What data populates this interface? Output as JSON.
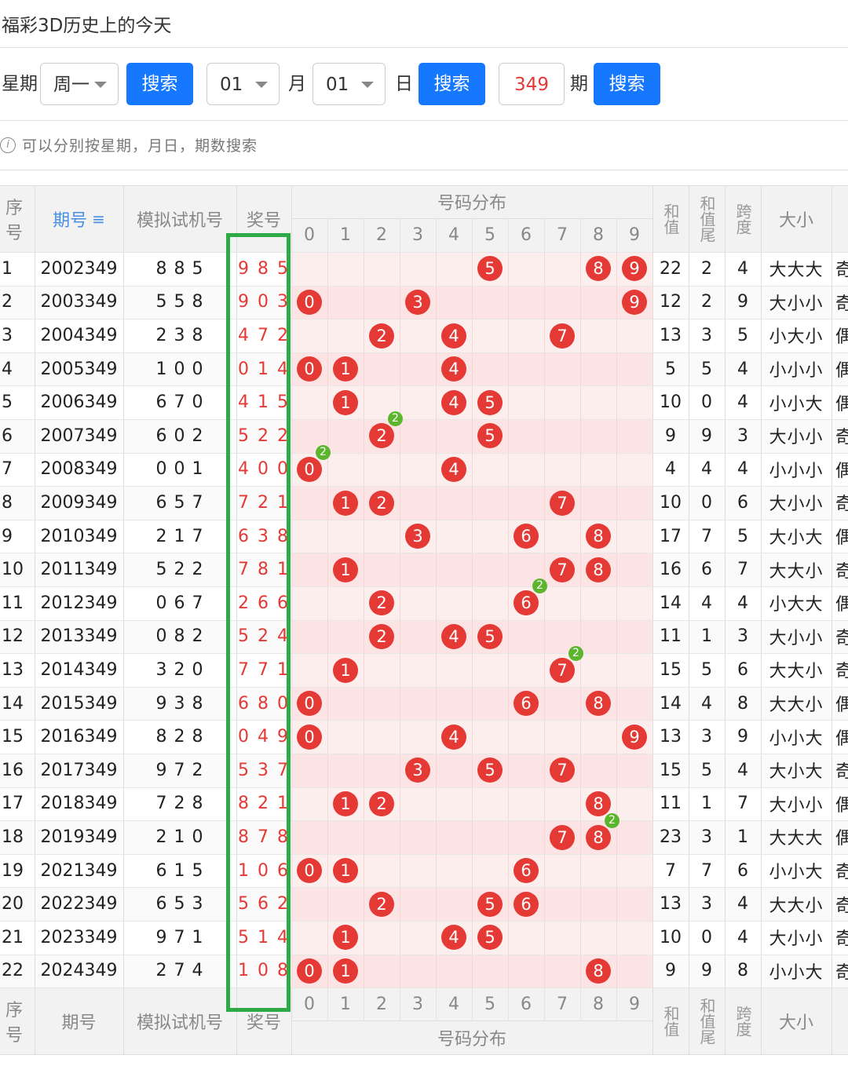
{
  "title": "福彩3D历史上的今天",
  "filters": {
    "weekday_label": "星期",
    "weekday_value": "周一",
    "search_label": "搜索",
    "month_value": "01",
    "month_label": "月",
    "day_value": "01",
    "day_label": "日",
    "issue_value": "349",
    "issue_label": "期"
  },
  "hint": "可以分别按星期，月日，期数搜索",
  "hint_icon": "info-icon",
  "table": {
    "headers": {
      "seq": "序号",
      "period": "期号",
      "period_sort_icon": "sort-icon",
      "sim": "模拟试机号",
      "prize": "奖号",
      "dist": "号码分布",
      "sum": "和值",
      "sum_tail": "和值尾",
      "span": "跨度",
      "size": "大小",
      "digits": [
        "0",
        "1",
        "2",
        "3",
        "4",
        "5",
        "6",
        "7",
        "8",
        "9"
      ]
    },
    "footer": {
      "seq": "序号",
      "period": "期号",
      "sim": "模拟试机号",
      "prize": "奖号",
      "dist": "号码分布",
      "sum": "和值",
      "sum_tail": "和值尾",
      "span": "跨度",
      "size": "大小"
    },
    "rows": [
      {
        "seq": "1",
        "period": "2002349",
        "sim": "8 8 5",
        "prize": "9 8 5",
        "balls": [
          5,
          8,
          9
        ],
        "dup": null,
        "sum": "22",
        "tail": "2",
        "span": "4",
        "size": "大大大",
        "extra": "奇"
      },
      {
        "seq": "2",
        "period": "2003349",
        "sim": "5 5 8",
        "prize": "9 0 3",
        "balls": [
          0,
          3,
          9
        ],
        "dup": null,
        "sum": "12",
        "tail": "2",
        "span": "9",
        "size": "大小小",
        "extra": "奇"
      },
      {
        "seq": "3",
        "period": "2004349",
        "sim": "2 3 8",
        "prize": "4 7 2",
        "balls": [
          2,
          4,
          7
        ],
        "dup": null,
        "sum": "13",
        "tail": "3",
        "span": "5",
        "size": "小大小",
        "extra": "偶"
      },
      {
        "seq": "4",
        "period": "2005349",
        "sim": "1 0 0",
        "prize": "0 1 4",
        "balls": [
          0,
          1,
          4
        ],
        "dup": null,
        "sum": "5",
        "tail": "5",
        "span": "4",
        "size": "小小小",
        "extra": "偶"
      },
      {
        "seq": "5",
        "period": "2006349",
        "sim": "6 7 0",
        "prize": "4 1 5",
        "balls": [
          1,
          4,
          5
        ],
        "dup": null,
        "sum": "10",
        "tail": "0",
        "span": "4",
        "size": "小小大",
        "extra": "偶"
      },
      {
        "seq": "6",
        "period": "2007349",
        "sim": "6 0 2",
        "prize": "5 2 2",
        "balls": [
          2,
          5
        ],
        "dup": 2,
        "sum": "9",
        "tail": "9",
        "span": "3",
        "size": "大小小",
        "extra": "奇"
      },
      {
        "seq": "7",
        "period": "2008349",
        "sim": "0 0 1",
        "prize": "4 0 0",
        "balls": [
          0,
          4
        ],
        "dup": 0,
        "sum": "4",
        "tail": "4",
        "span": "4",
        "size": "小小小",
        "extra": "偶"
      },
      {
        "seq": "8",
        "period": "2009349",
        "sim": "6 5 7",
        "prize": "7 2 1",
        "balls": [
          1,
          2,
          7
        ],
        "dup": null,
        "sum": "10",
        "tail": "0",
        "span": "6",
        "size": "大小小",
        "extra": "奇"
      },
      {
        "seq": "9",
        "period": "2010349",
        "sim": "2 1 7",
        "prize": "6 3 8",
        "balls": [
          3,
          6,
          8
        ],
        "dup": null,
        "sum": "17",
        "tail": "7",
        "span": "5",
        "size": "大小大",
        "extra": "偶"
      },
      {
        "seq": "10",
        "period": "2011349",
        "sim": "5 2 2",
        "prize": "7 8 1",
        "balls": [
          1,
          7,
          8
        ],
        "dup": null,
        "sum": "16",
        "tail": "6",
        "span": "7",
        "size": "大大小",
        "extra": "奇"
      },
      {
        "seq": "11",
        "period": "2012349",
        "sim": "0 6 7",
        "prize": "2 6 6",
        "balls": [
          2,
          6
        ],
        "dup": 6,
        "sum": "14",
        "tail": "4",
        "span": "4",
        "size": "小大大",
        "extra": "偶"
      },
      {
        "seq": "12",
        "period": "2013349",
        "sim": "0 8 2",
        "prize": "5 2 4",
        "balls": [
          2,
          4,
          5
        ],
        "dup": null,
        "sum": "11",
        "tail": "1",
        "span": "3",
        "size": "大小小",
        "extra": "奇"
      },
      {
        "seq": "13",
        "period": "2014349",
        "sim": "3 2 0",
        "prize": "7 7 1",
        "balls": [
          1,
          7
        ],
        "dup": 7,
        "sum": "15",
        "tail": "5",
        "span": "6",
        "size": "大大小",
        "extra": "奇"
      },
      {
        "seq": "14",
        "period": "2015349",
        "sim": "9 3 8",
        "prize": "6 8 0",
        "balls": [
          0,
          6,
          8
        ],
        "dup": null,
        "sum": "14",
        "tail": "4",
        "span": "8",
        "size": "大大小",
        "extra": "偶"
      },
      {
        "seq": "15",
        "period": "2016349",
        "sim": "8 2 8",
        "prize": "0 4 9",
        "balls": [
          0,
          4,
          9
        ],
        "dup": null,
        "sum": "13",
        "tail": "3",
        "span": "9",
        "size": "小小大",
        "extra": "偶"
      },
      {
        "seq": "16",
        "period": "2017349",
        "sim": "9 7 2",
        "prize": "5 3 7",
        "balls": [
          3,
          5,
          7
        ],
        "dup": null,
        "sum": "15",
        "tail": "5",
        "span": "4",
        "size": "大小大",
        "extra": "奇"
      },
      {
        "seq": "17",
        "period": "2018349",
        "sim": "7 2 8",
        "prize": "8 2 1",
        "balls": [
          1,
          2,
          8
        ],
        "dup": null,
        "sum": "11",
        "tail": "1",
        "span": "7",
        "size": "大小小",
        "extra": "偶"
      },
      {
        "seq": "18",
        "period": "2019349",
        "sim": "2 1 0",
        "prize": "8 7 8",
        "balls": [
          7,
          8
        ],
        "dup": 8,
        "sum": "23",
        "tail": "3",
        "span": "1",
        "size": "大大大",
        "extra": "偶"
      },
      {
        "seq": "19",
        "period": "2021349",
        "sim": "6 1 5",
        "prize": "1 0 6",
        "balls": [
          0,
          1,
          6
        ],
        "dup": null,
        "sum": "7",
        "tail": "7",
        "span": "6",
        "size": "小小大",
        "extra": "奇"
      },
      {
        "seq": "20",
        "period": "2022349",
        "sim": "6 5 3",
        "prize": "5 6 2",
        "balls": [
          2,
          5,
          6
        ],
        "dup": null,
        "sum": "13",
        "tail": "3",
        "span": "4",
        "size": "大大小",
        "extra": "奇"
      },
      {
        "seq": "21",
        "period": "2023349",
        "sim": "9 7 1",
        "prize": "5 1 4",
        "balls": [
          1,
          4,
          5
        ],
        "dup": null,
        "sum": "10",
        "tail": "0",
        "span": "4",
        "size": "大小小",
        "extra": "奇"
      },
      {
        "seq": "22",
        "period": "2024349",
        "sim": "2 7 4",
        "prize": "1 0 8",
        "balls": [
          0,
          1,
          8
        ],
        "dup": null,
        "sum": "9",
        "tail": "9",
        "span": "8",
        "size": "小小大",
        "extra": "奇"
      }
    ],
    "dup_badge_text": "2"
  },
  "colors": {
    "accent_blue": "#1677ff",
    "ball_red": "#e53935",
    "badge_green": "#5bb52d",
    "highlight_green": "#2eaa46",
    "zebra_pink": "#fdeeee"
  }
}
